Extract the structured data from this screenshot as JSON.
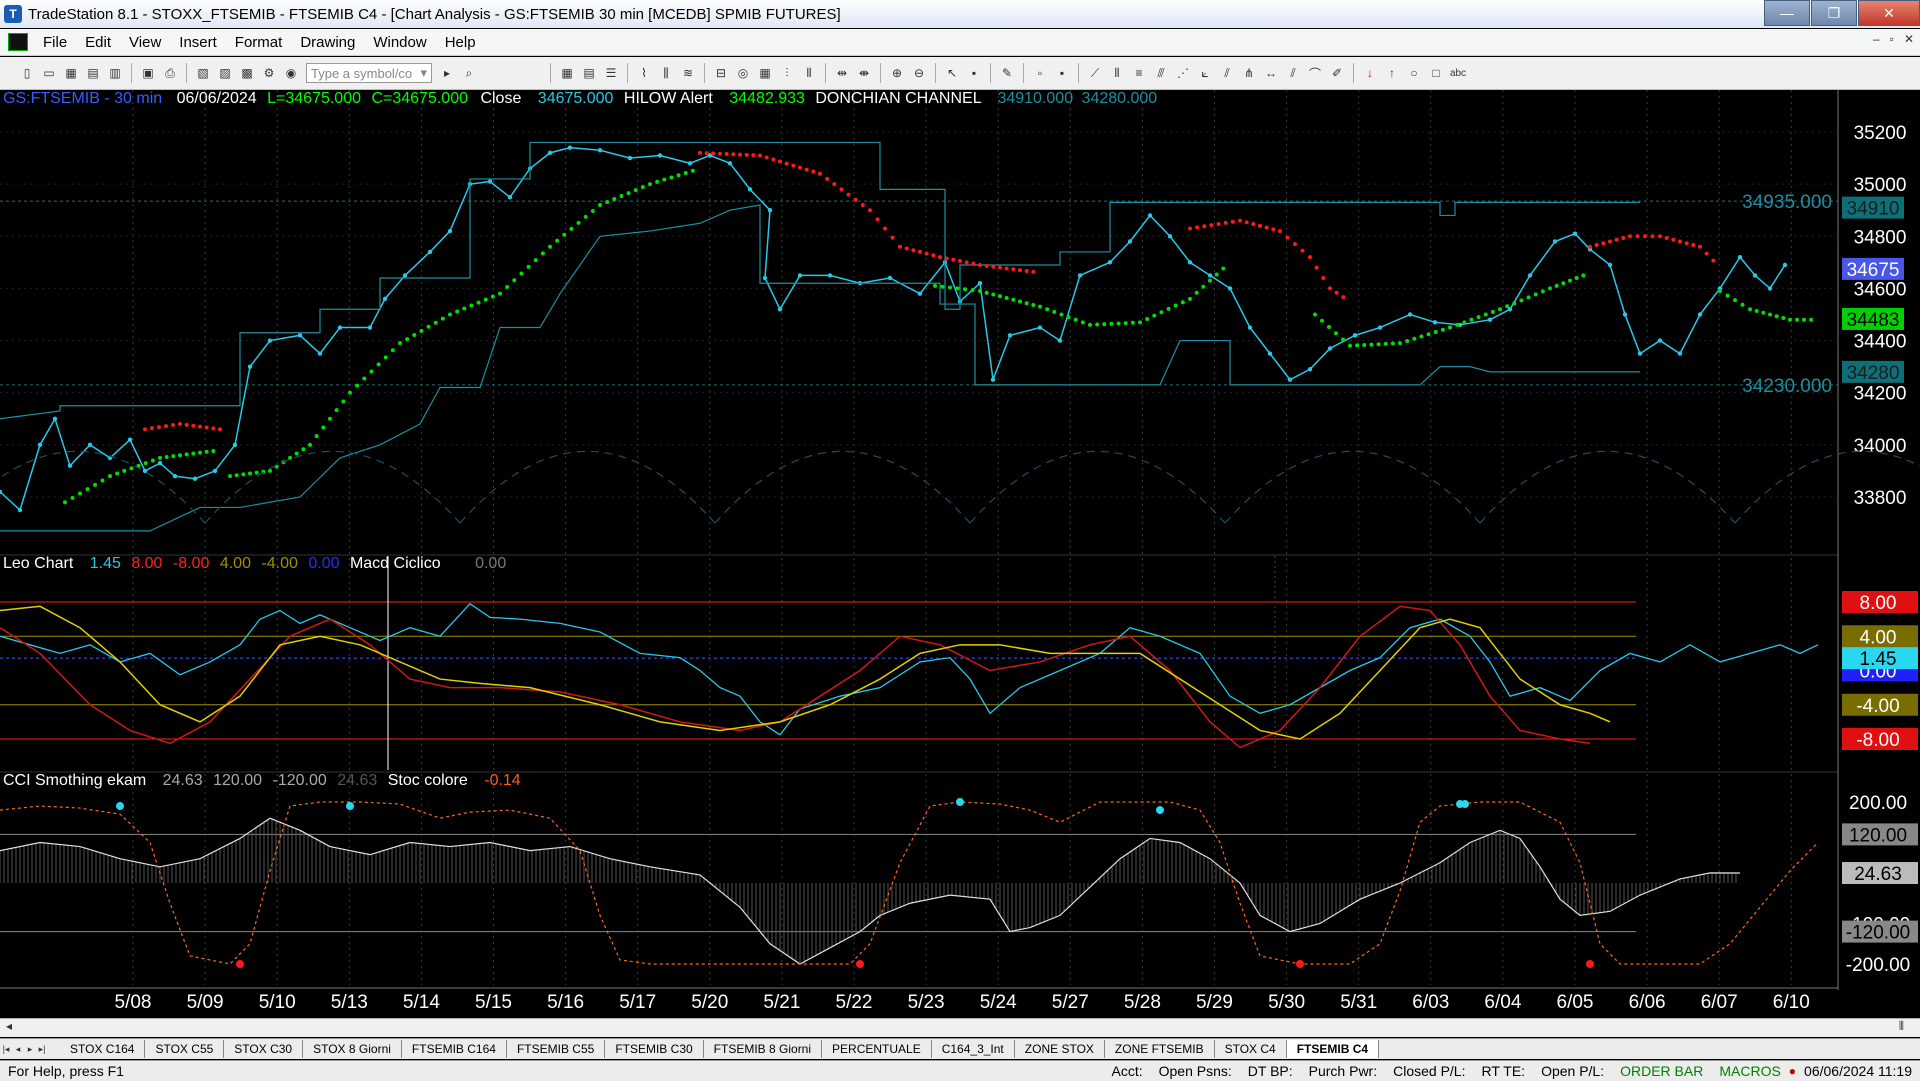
{
  "window": {
    "title": "TradeStation 8.1 - STOXX_FTSEMIB - FTSEMIB C4 - [Chart Analysis - GS:FTSEMIB  30 min  [MCEDB] SPMIB FUTURES]",
    "minimize_glyph": "—",
    "maximize_glyph": "❐",
    "close_glyph": "✕"
  },
  "menu": [
    "File",
    "Edit",
    "View",
    "Insert",
    "Format",
    "Drawing",
    "Window",
    "Help"
  ],
  "toolbar": {
    "symbol_placeholder": "Type a symbol/co"
  },
  "price_header": {
    "symbol": "GS:FTSEMIB - 30 min",
    "date": "06/06/2024",
    "low": "L=34675.000",
    "close": "C=34675.000",
    "close_label": "Close",
    "close_value": "34675.000",
    "hilow_label": "HILOW Alert",
    "hilow_value": "34482.933",
    "donchian_label": "DONCHIAN CHANNEL",
    "donchian_upper": "34910.000",
    "donchian_lower": "34280.000"
  },
  "price_axis": {
    "ticks": [
      "35200",
      "35000",
      "34800",
      "34600",
      "34400",
      "34200",
      "34000",
      "33800"
    ],
    "ref_upper": "34935.000",
    "ref_lower": "34230.000",
    "marker_upper": "34910",
    "marker_close": "34675",
    "marker_hilow": "34483",
    "marker_lower": "34280"
  },
  "macd_header": {
    "name": "Leo Chart",
    "v1": "1.45",
    "v2": "8.00",
    "v3": "-8.00",
    "v4": "4.00",
    "v5": "-4.00",
    "v6": "0.00",
    "name2": "Macd Ciclico",
    "v7": "0.00"
  },
  "macd_axis": {
    "m8": "8.00",
    "m4": "4.00",
    "m145": "1.45",
    "m0": "0.00",
    "mn4": "-4.00",
    "mn8": "-8.00"
  },
  "cci_header": {
    "name": "CCI Smothing ekam",
    "v1": "24.63",
    "v2": "120.00",
    "v3": "-120.00",
    "v4": "24.63",
    "name2": "Stoc colore",
    "v5": "-0.14"
  },
  "cci_axis": {
    "t200": "200.00",
    "m120": "120.00",
    "m24": "24.63",
    "tn100": "-100.00",
    "mn120": "-120.00",
    "tn200": "-200.00"
  },
  "dates": [
    "5/08",
    "5/09",
    "5/10",
    "5/13",
    "5/14",
    "5/15",
    "5/16",
    "5/17",
    "5/20",
    "5/21",
    "5/22",
    "5/23",
    "5/24",
    "5/27",
    "5/28",
    "5/29",
    "5/30",
    "5/31",
    "6/03",
    "6/04",
    "6/05",
    "6/06",
    "6/07",
    "6/10"
  ],
  "tabs": [
    "STOX C164",
    "STOX C55",
    "STOX  C30",
    "STOX  8 Giorni",
    "FTSEMIB C164",
    "FTSEMIB C55",
    "FTSEMIB C30",
    "FTSEMIB  8 Giorni",
    "PERCENTUALE",
    "C164_3_Int",
    "ZONE STOX",
    "ZONE FTSEMIB",
    "STOX  C4",
    "FTSEMIB C4"
  ],
  "status": {
    "help": "For Help, press F1",
    "acct": "Acct:",
    "open_psns": "Open Psns:",
    "dt_bp": "DT BP:",
    "purch_pwr": "Purch Pwr:",
    "closed_pl": "Closed P/L:",
    "rt_te": "RT TE:",
    "open_pl": "Open P/L:",
    "order_bar": "ORDER BAR",
    "macros": "MACROS",
    "datetime": "06/06/2024 11:19"
  },
  "colors": {
    "price": "#29c8e8",
    "hilow_up": "#00e000",
    "hilow_down": "#ff1a1a",
    "donchian": "#1d8fa0",
    "grid": "#3a3a3a",
    "macd_red": "#ff2020",
    "macd_yellow": "#e0d000"
  }
}
